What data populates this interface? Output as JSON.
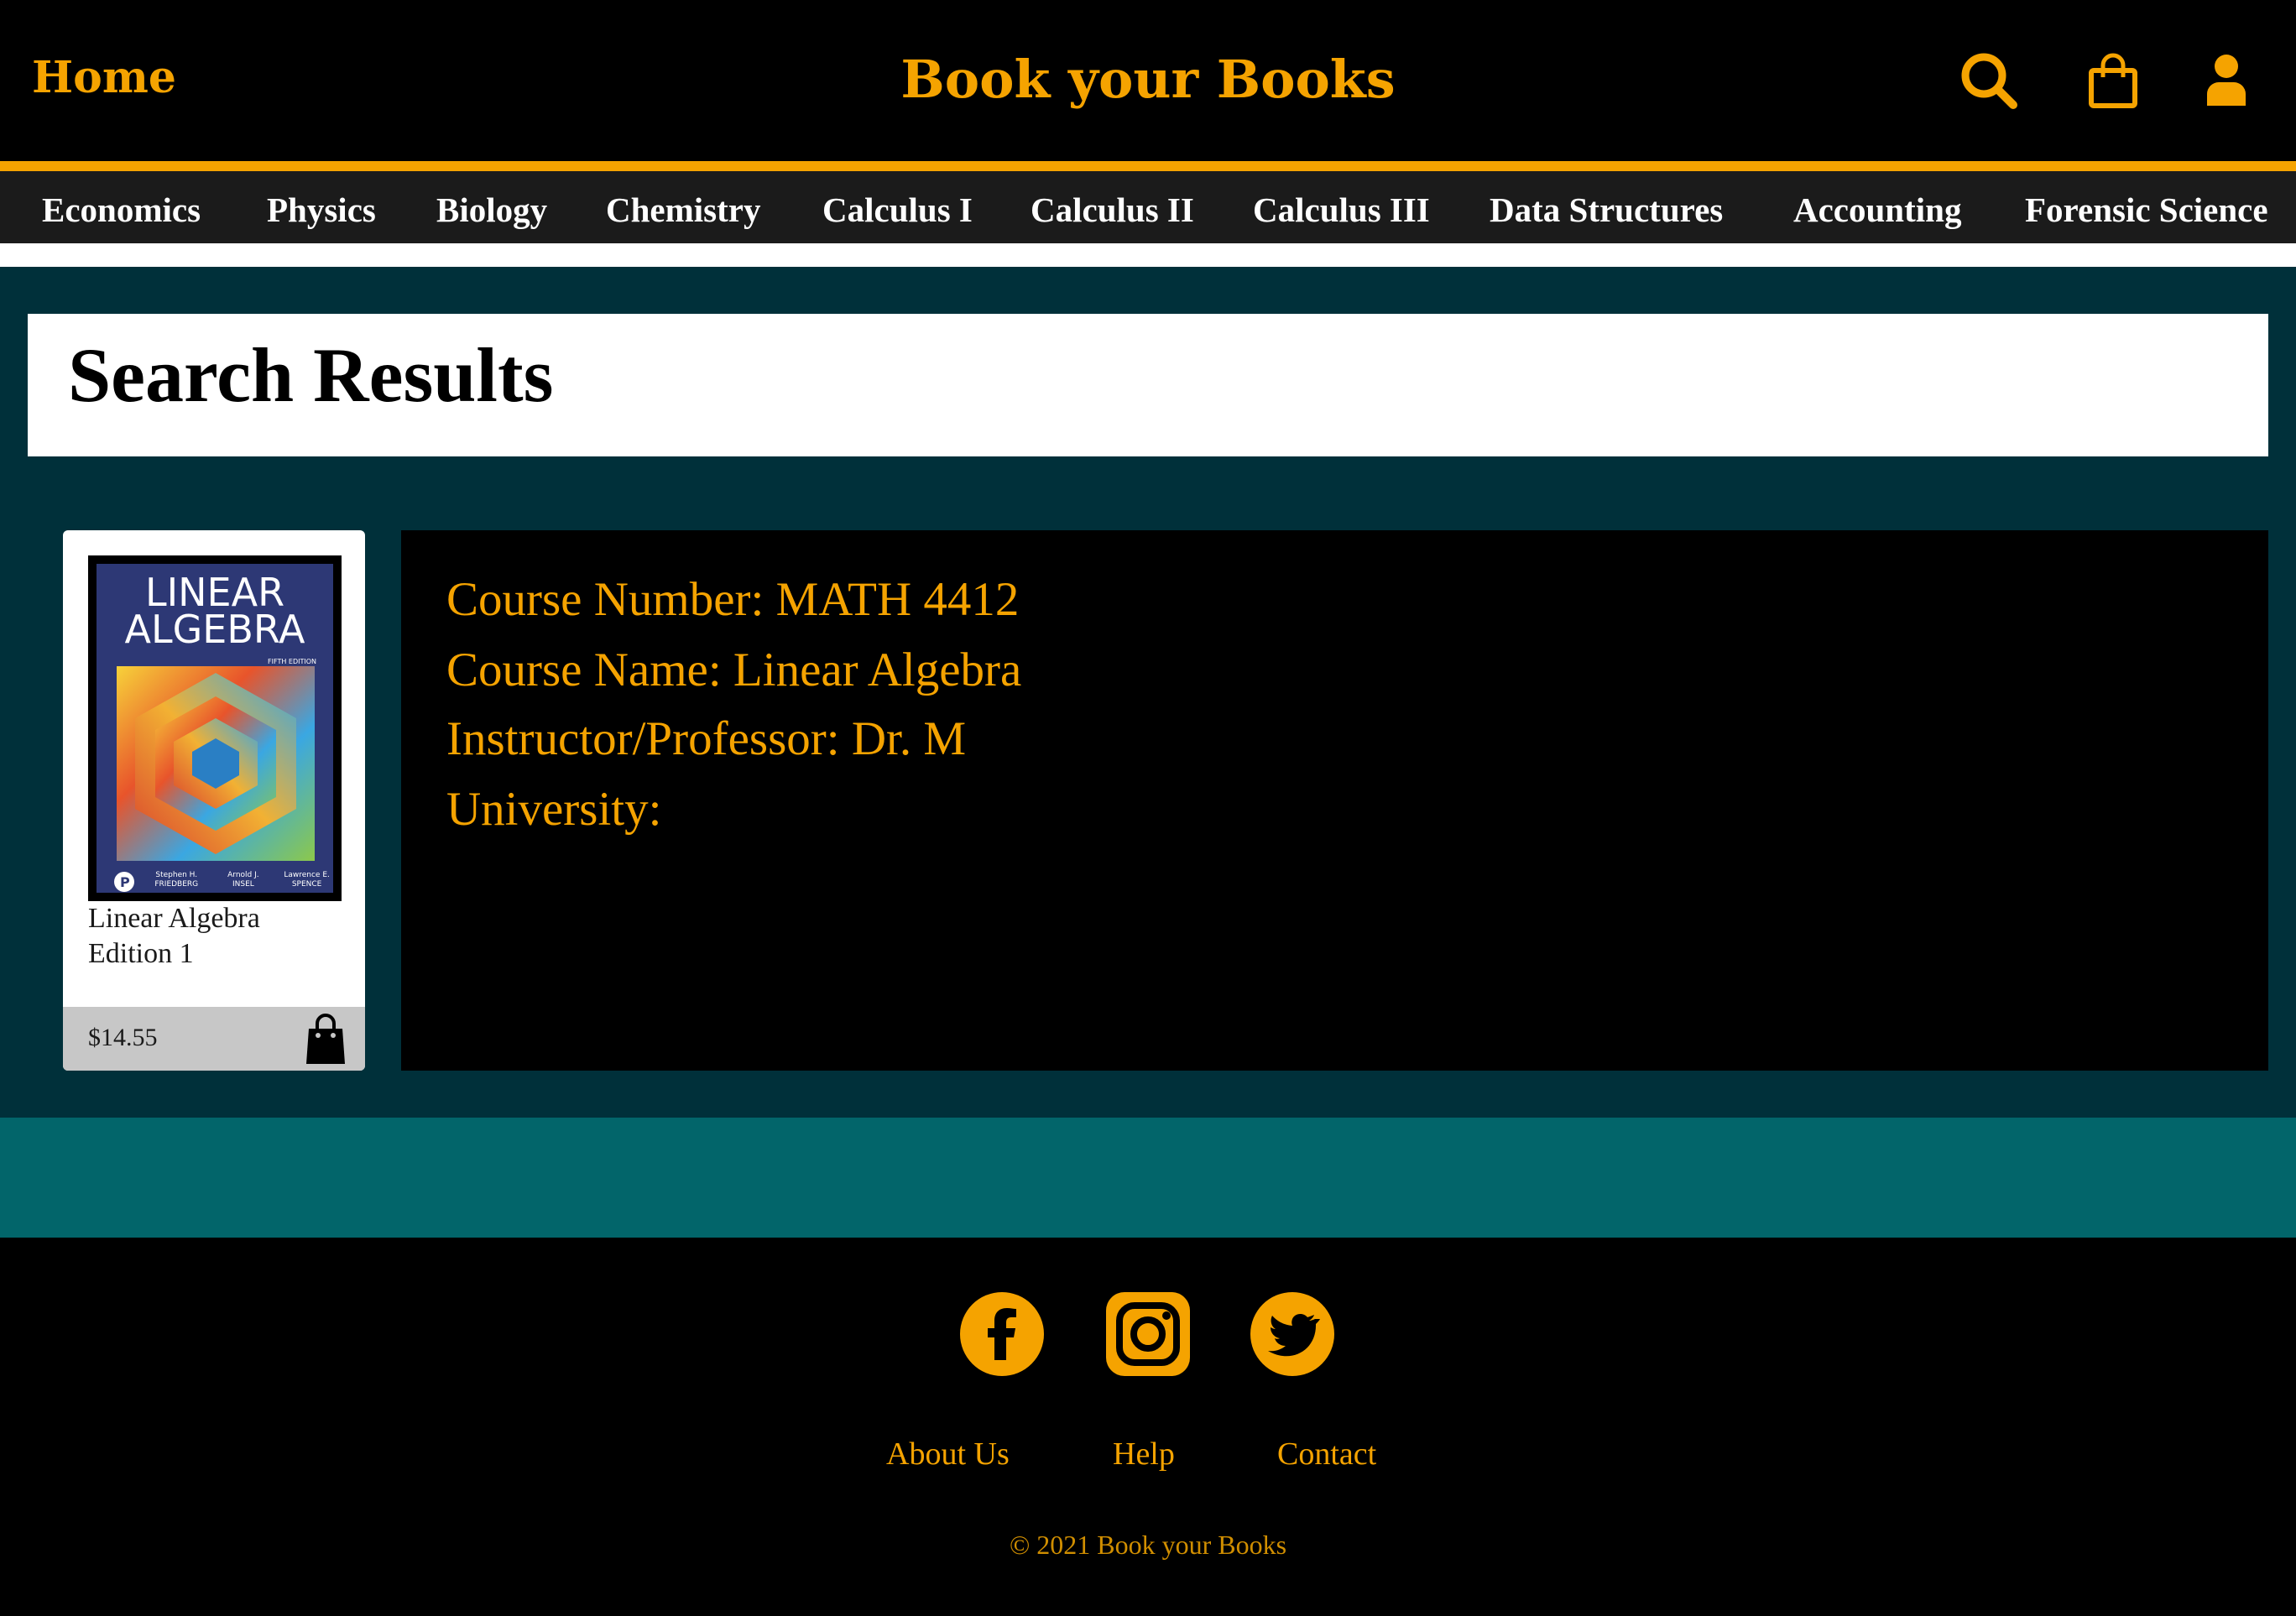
{
  "header": {
    "home_label": "Home",
    "brand": "Book your Books",
    "icons": [
      "search-icon",
      "shopping-bag-icon",
      "user-icon"
    ]
  },
  "categories": [
    "Economics",
    "Physics",
    "Biology",
    "Chemistry",
    "Calculus I",
    "Calculus II",
    "Calculus III",
    "Data Structures",
    "Accounting",
    "Forensic Science"
  ],
  "main": {
    "title": "Search Results",
    "book": {
      "cover_title_line1": "LINEAR",
      "cover_title_line2": "ALGEBRA",
      "cover_edition": "FIFTH EDITION",
      "cover_authors": [
        "Stephen H. FRIEDBERG",
        "Arnold J. INSEL",
        "Lawrence E. SPENCE"
      ],
      "name_line1": "Linear Algebra",
      "name_line2": "Edition 1",
      "price": "$14.55"
    },
    "details": {
      "course_number": "Course Number: MATH 4412",
      "course_name": "Course Name: Linear Algebra",
      "instructor": "Instructor/Professor: Dr. M",
      "university": "University:"
    }
  },
  "footer": {
    "social": [
      "facebook-icon",
      "instagram-icon",
      "twitter-icon"
    ],
    "links": [
      "About Us",
      "Help",
      "Contact"
    ],
    "copyright": "© 2021 Book your Books"
  },
  "colors": {
    "accent": "#f5a300",
    "main_bg": "#00303a",
    "band": "#02656a",
    "nav_bg": "#1b1b1b"
  }
}
